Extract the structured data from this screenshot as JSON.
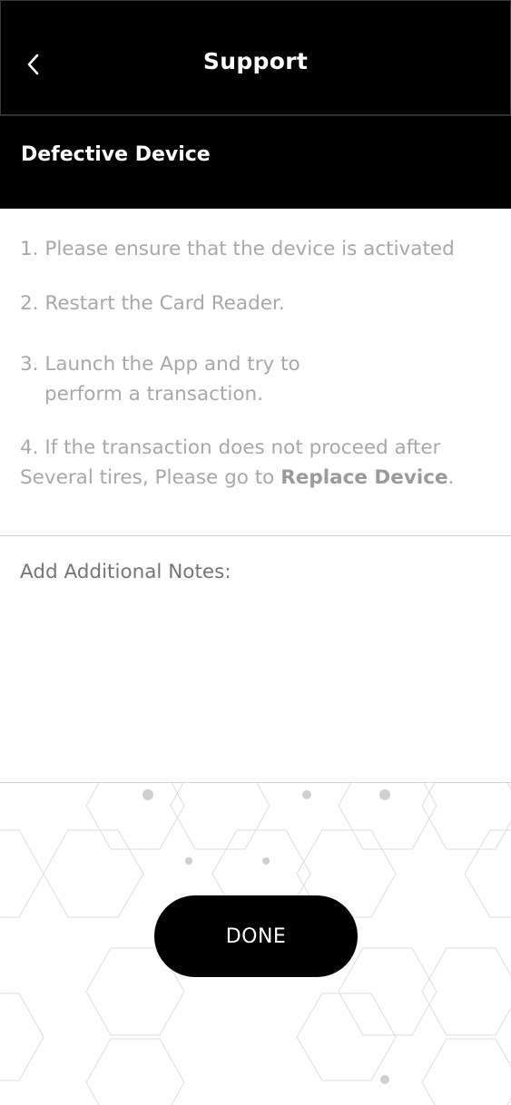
{
  "header": {
    "title": "Support",
    "back_icon": "chevron-left-icon"
  },
  "section": {
    "title": "Defective Device"
  },
  "steps": {
    "step1": "1. Please ensure that the device is activated",
    "step2": "2. Restart the Card Reader.",
    "step3_line1": "3. Launch the App and try to",
    "step3_line2": "perform a transaction.",
    "step4_line1": "4. If the transaction does not proceed after",
    "step4_line2_prefix": "Several tires, Please go to ",
    "step4_link": "Replace Device",
    "step4_suffix": "."
  },
  "notes": {
    "placeholder": "Add Additional Notes:"
  },
  "footer": {
    "done_label": "DONE"
  },
  "colors": {
    "primary": "#000000",
    "text_muted": "#a8a8a8",
    "divider": "#d4d4d4"
  }
}
